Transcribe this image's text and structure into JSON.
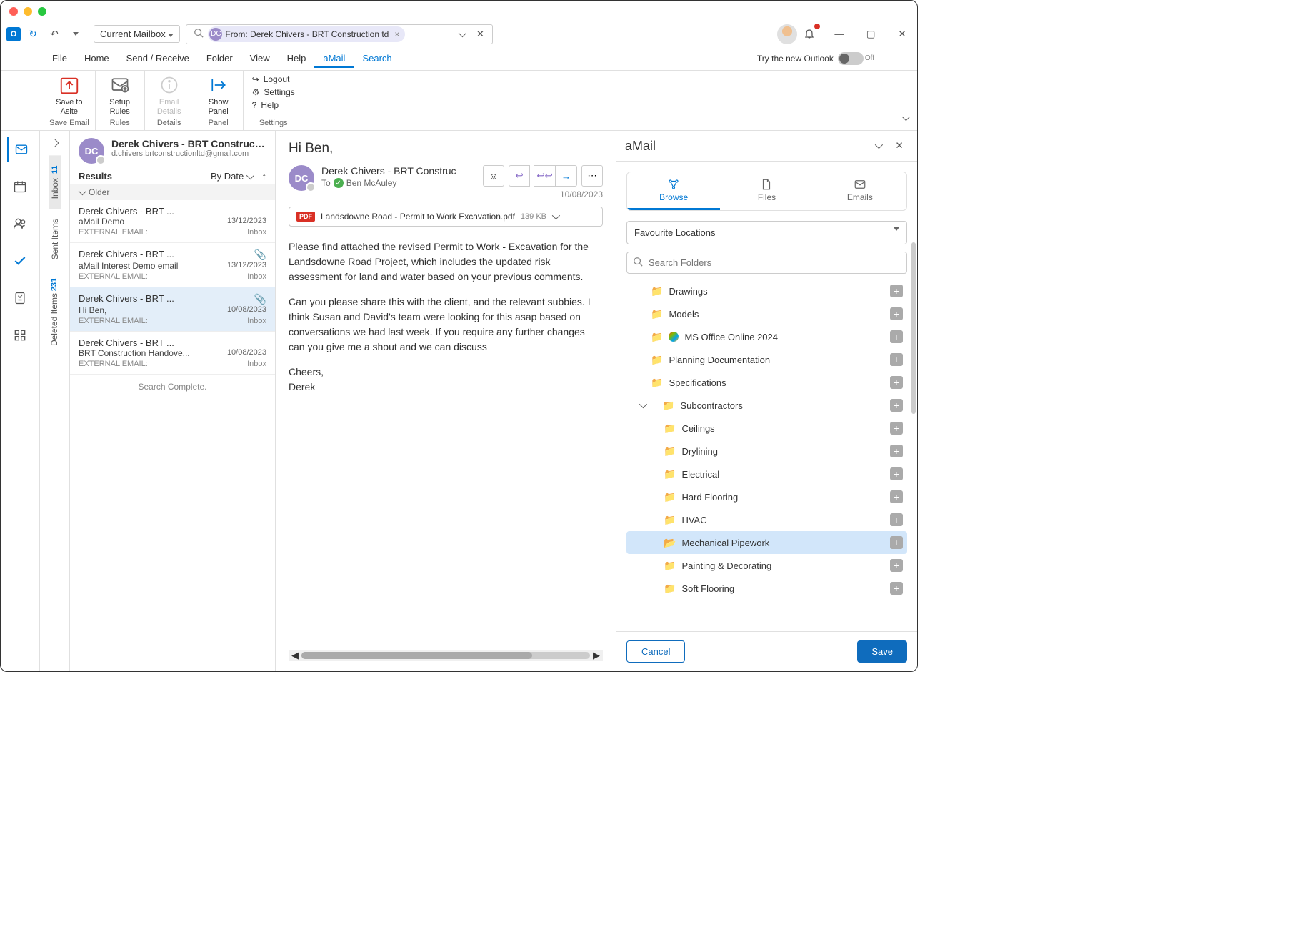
{
  "titlebar": {},
  "topbar": {
    "mailbox": "Current Mailbox",
    "search_chip": "From: Derek Chivers - BRT Construction td"
  },
  "tabs": {
    "file": "File",
    "home": "Home",
    "sendrecv": "Send / Receive",
    "folder": "Folder",
    "view": "View",
    "help": "Help",
    "amail": "aMail",
    "search": "Search",
    "try_new": "Try the new Outlook",
    "toggle": "Off"
  },
  "ribbon": {
    "save_to_asite": "Save to Asite",
    "save_email": "Save Email",
    "setup_rules": "Setup Rules",
    "rules": "Rules",
    "email_details": "Email Details",
    "details": "Details",
    "show_panel": "Show Panel",
    "panel": "Panel",
    "logout": "Logout",
    "settings": "Settings",
    "help": "Help",
    "settings_grp": "Settings"
  },
  "folders": {
    "inbox": "Inbox",
    "inbox_badge": "11",
    "sent": "Sent Items",
    "deleted": "Deleted Items",
    "deleted_badge": "231"
  },
  "list": {
    "from_name": "Derek Chivers - BRT Constructi...",
    "from_email": "d.chivers.brtconstructionltd@gmail.com",
    "results": "Results",
    "by_date": "By Date",
    "older": "Older",
    "items": [
      {
        "from": "Derek Chivers - BRT ...",
        "sub": "aMail Demo",
        "date": "13/12/2023",
        "folder": "Inbox",
        "ext": "EXTERNAL EMAIL:",
        "attach": false
      },
      {
        "from": "Derek Chivers - BRT ...",
        "sub": "aMail Interest Demo email",
        "date": "13/12/2023",
        "folder": "Inbox",
        "ext": "EXTERNAL EMAIL:",
        "attach": true
      },
      {
        "from": "Derek Chivers - BRT ...",
        "sub": "Hi Ben,",
        "date": "10/08/2023",
        "folder": "Inbox",
        "ext": "EXTERNAL EMAIL:",
        "attach": true
      },
      {
        "from": "Derek Chivers - BRT ...",
        "sub": "BRT Construction Handove...",
        "date": "10/08/2023",
        "folder": "Inbox",
        "ext": "EXTERNAL EMAIL:",
        "attach": false
      }
    ],
    "search_complete": "Search Complete."
  },
  "reader": {
    "subject": "Hi Ben,",
    "from": "Derek Chivers - BRT Construc",
    "to_label": "To",
    "to_name": "Ben McAuley",
    "date": "10/08/2023",
    "attach_name": "Landsdowne Road - Permit to Work Excavation.pdf",
    "attach_size": "139 KB",
    "para1": "Please find attached the revised Permit to Work - Excavation for the Landsdowne Road Project, which includes the updated risk assessment for land and water based on your previous comments.",
    "para2": "Can you please share this with the client, and the relevant subbies. I think Susan and David's team were looking for this asap based on conversations we had last week. If you require any further changes can you give me a shout and we can discuss",
    "para3": "Cheers,",
    "para4": "Derek"
  },
  "amail": {
    "title": "aMail",
    "tab_browse": "Browse",
    "tab_files": "Files",
    "tab_emails": "Emails",
    "fav_loc": "Favourite Locations",
    "search_placeholder": "Search Folders",
    "folders": {
      "drawings": "Drawings",
      "models": "Models",
      "msoffice": "MS Office Online 2024",
      "planning": "Planning Documentation",
      "specs": "Specifications",
      "subcon": "Subcontractors",
      "ceilings": "Ceilings",
      "drylining": "Drylining",
      "electrical": "Electrical",
      "hardfloor": "Hard Flooring",
      "hvac": "HVAC",
      "mechpipe": "Mechanical Pipework",
      "painting": "Painting & Decorating",
      "softfloor": "Soft Flooring"
    },
    "cancel": "Cancel",
    "save": "Save"
  }
}
